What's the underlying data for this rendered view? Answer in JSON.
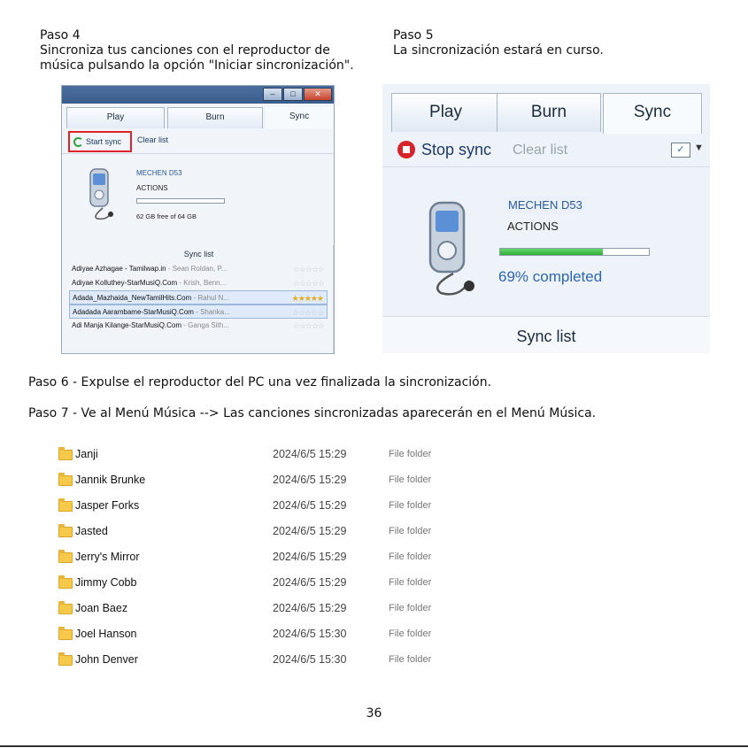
{
  "step4": {
    "title": "Paso 4",
    "line1": "Sincroniza tus canciones con el reproductor de",
    "line2": "música pulsando la opción \"Iniciar sincronización\"."
  },
  "step5": {
    "title": "Paso 5",
    "line1": "La sincronización estará en curso."
  },
  "step6": {
    "text": "Paso 6 - Expulse el reproductor del PC una vez finalizada la sincronización."
  },
  "step7": {
    "text": "Paso 7 - Ve al Menú Música --> Las canciones sincronizadas aparecerán en el Menú Música."
  },
  "screenshot1": {
    "tabs": [
      "Play",
      "Burn",
      "Sync"
    ],
    "start_sync": "Start sync",
    "clear_list": "Clear list",
    "device_name": "MECHEN D53",
    "device_actions": "ACTIONS",
    "free_space": "62 GB free of 64 GB",
    "sync_list_title": "Sync list",
    "rows": [
      {
        "title": "Adiyae Azhagae - Tamilwap.in",
        "artist": " - Sean Roldan, P...",
        "rated": false,
        "selected": false
      },
      {
        "title": "Adiyae Kolluthey-StarMusiQ.Com",
        "artist": " - Krish, Benn...",
        "rated": false,
        "selected": false
      },
      {
        "title": "Adada_Mazhaida_NewTamilHits.Com",
        "artist": " - Rahul N...",
        "rated": true,
        "selected": true
      },
      {
        "title": "Adadada Aarambame-StarMusiQ.Com",
        "artist": " - Shanka...",
        "rated": false,
        "selected": true
      },
      {
        "title": "Adi Manja Kilange-StarMusiQ.Com",
        "artist": " - Ganga Sith...",
        "rated": false,
        "selected": false
      }
    ],
    "stars": "☆☆☆☆☆",
    "stars_on": "★★★★★"
  },
  "screenshot2": {
    "tabs": [
      "Play",
      "Burn",
      "Sync"
    ],
    "stop_sync": "Stop sync",
    "clear_list": "Clear list",
    "device_name": "MECHEN D53",
    "device_actions": "ACTIONS",
    "progress": 0.69,
    "progress_text": "69% completed",
    "sync_list_title": "Sync list"
  },
  "folders": [
    {
      "name": "Janji",
      "date": "2024/6/5 15:29",
      "type": "File folder"
    },
    {
      "name": "Jannik Brunke",
      "date": "2024/6/5 15:29",
      "type": "File folder"
    },
    {
      "name": "Jasper Forks",
      "date": "2024/6/5 15:29",
      "type": "File folder"
    },
    {
      "name": "Jasted",
      "date": "2024/6/5 15:29",
      "type": "File folder"
    },
    {
      "name": "Jerry's Mirror",
      "date": "2024/6/5 15:29",
      "type": "File folder"
    },
    {
      "name": "Jimmy Cobb",
      "date": "2024/6/5 15:29",
      "type": "File folder"
    },
    {
      "name": "Joan Baez",
      "date": "2024/6/5 15:29",
      "type": "File folder"
    },
    {
      "name": "Joel Hanson",
      "date": "2024/6/5 15:30",
      "type": "File folder"
    },
    {
      "name": "John Denver",
      "date": "2024/6/5 15:30",
      "type": "File folder"
    }
  ],
  "page_number": "36",
  "colors": {
    "highlight_border": "#e0232b",
    "progress_green": "#2fae38",
    "link_blue": "#2d66b5",
    "folder_yellow": "#f6c94a"
  }
}
